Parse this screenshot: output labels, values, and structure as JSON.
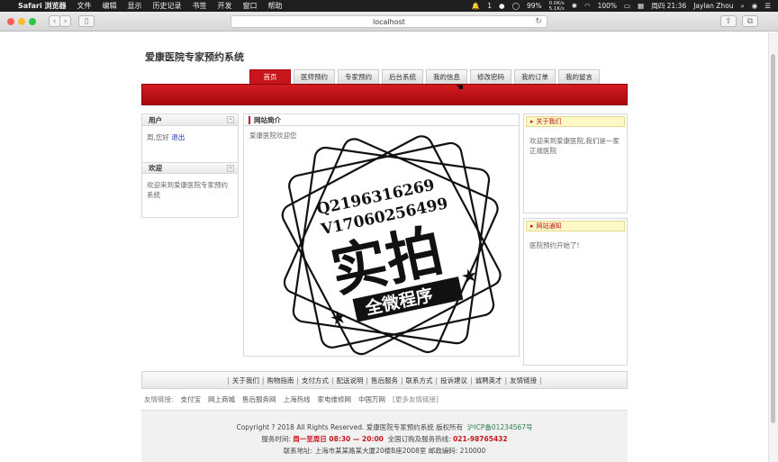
{
  "menubar": {
    "app": "Safari 浏览器",
    "menus": [
      "文件",
      "编辑",
      "显示",
      "历史记录",
      "书签",
      "开发",
      "窗口",
      "帮助"
    ],
    "battery": "99%",
    "net_up": "0.0K/s",
    "net_down": "5.1K/s",
    "battery2": "100%",
    "datetime": "周四 21:36",
    "user": "Jaylan Zhou",
    "notif": "1"
  },
  "browser": {
    "url": "localhost"
  },
  "site": {
    "title": "爱康医院专家预约系统",
    "nav": [
      "首页",
      "医师预约",
      "专家预约",
      "后台系统",
      "我的信息",
      "修改密码",
      "我的订单",
      "我的留言"
    ]
  },
  "left": {
    "user_box": {
      "title": "用户",
      "greeting": "周,您好",
      "logout": "退出"
    },
    "welcome_box": {
      "title": "欢迎",
      "text": "欢迎来到爱康医院专家预约系统"
    }
  },
  "center": {
    "title": "网站简介",
    "text": "爱康医院欢迎您"
  },
  "right": {
    "about": {
      "title": "关于我们",
      "text": "欢迎来到爱康医院,我们是一家正规医院"
    },
    "notice": {
      "title": "网站通知",
      "text": "医院预约开始了!"
    }
  },
  "watermark": {
    "qq": "Q2196316269",
    "v": "V17060256499",
    "big": "实拍",
    "small": "全微程序"
  },
  "footer": {
    "links": [
      "关于我们",
      "购物指南",
      "支付方式",
      "配送说明",
      "售后服务",
      "联系方式",
      "投诉建议",
      "诚聘英才",
      "友情链接"
    ],
    "friend_label": "友情链接:",
    "friends": [
      "支付宝",
      "网上商城",
      "售后服务网",
      "上海热线",
      "家电维修网",
      "中国万网"
    ],
    "friend_more": "[更多友情链接]",
    "copyright": "Copyright ? 2018 All Rights Reserved. 爱康医院专家预约系统 版权所有",
    "icp": "沪ICP备01234567号",
    "service_label": "服务时间:",
    "service_time": "周一至周日 08:30 — 20:00",
    "hotline_label": "全国订购及服务热线:",
    "hotline": "021-98765432",
    "address": "联系地址: 上海市某某路某大厦20楼B座2008室   邮政编码: 210000"
  }
}
